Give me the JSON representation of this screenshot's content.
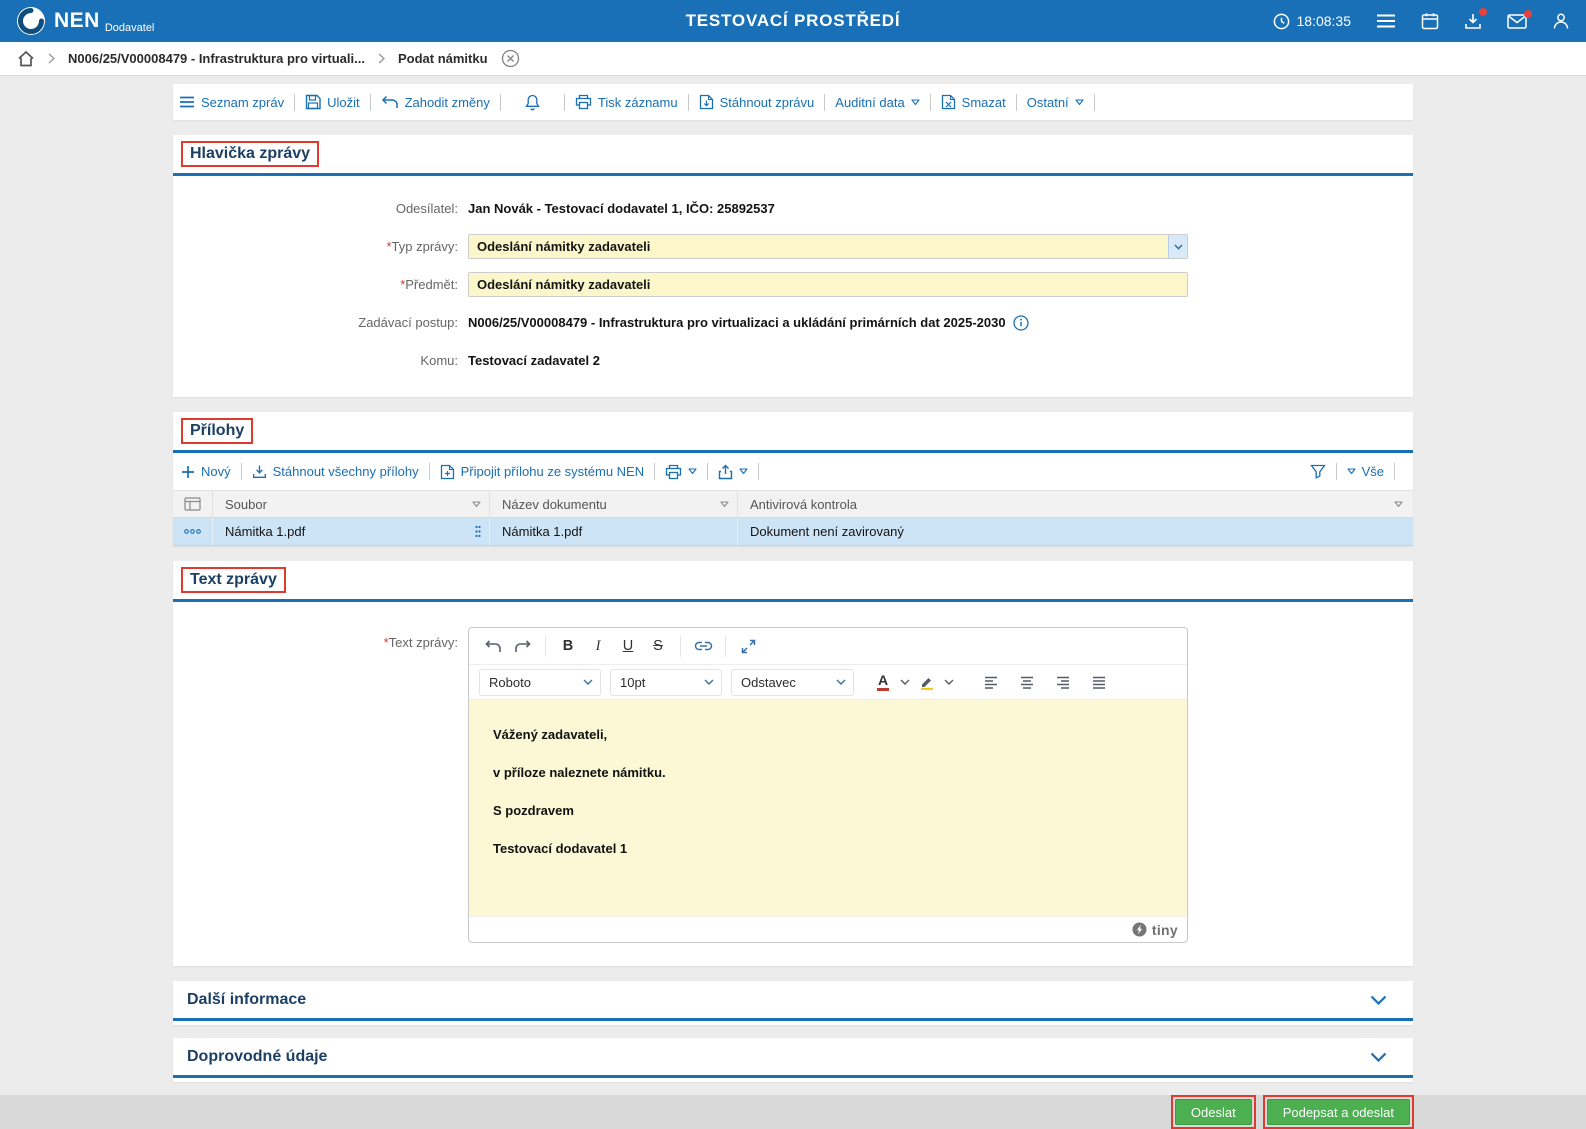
{
  "colors": {
    "header_blue": "#1a70b6",
    "link_blue": "#1a6fb5",
    "required_field_yellow": "#fcf7ca",
    "annotation_red": "#e03a2f",
    "selected_row_blue": "#cde3f6",
    "button_green": "#4caf50",
    "section_title_navy": "#1c4064"
  },
  "top_bar": {
    "brand": "NEN",
    "brand_sub": "Dodavatel",
    "title": "TESTOVACÍ PROSTŘEDÍ",
    "time": "18:08:35"
  },
  "breadcrumb": {
    "items": [
      {
        "label": "N006/25/V00008479 - Infrastruktura pro virtuali..."
      },
      {
        "label": "Podat námitku"
      }
    ]
  },
  "toolbar": {
    "items": [
      {
        "label": "Seznam zpráv"
      },
      {
        "label": "Uložit"
      },
      {
        "label": "Zahodit změny"
      },
      {
        "label": "Tisk záznamu"
      },
      {
        "label": "Stáhnout zprávu"
      },
      {
        "label": "Auditní data"
      },
      {
        "label": "Smazat"
      },
      {
        "label": "Ostatní"
      }
    ]
  },
  "misc": {
    "required_mark": "*"
  },
  "message_header": {
    "title": "Hlavička zprávy",
    "sender_label": "Odesílatel:",
    "sender_value": "Jan Novák - Testovací dodavatel 1, IČO: 25892537",
    "type_label": "Typ zprávy:",
    "type_value": "Odeslání námitky zadavateli",
    "subject_label": "Předmět:",
    "subject_value": "Odeslání námitky zadavateli",
    "procedure_label": "Zadávací postup:",
    "procedure_value": "N006/25/V00008479 - Infrastruktura pro virtualizaci a ukládání primárních dat 2025-2030",
    "recipient_label": "Komu:",
    "recipient_value": "Testovací zadavatel 2"
  },
  "attachments": {
    "title": "Přílohy",
    "toolbar": {
      "new": "Nový",
      "download_all": "Stáhnout všechny přílohy",
      "attach_nen": "Připojit přílohu ze systému NEN",
      "all": "Vše"
    },
    "columns": [
      "Soubor",
      "Název dokumentu",
      "Antivirová kontrola"
    ],
    "rows": [
      {
        "file": "Námitka 1.pdf",
        "document_name": "Námitka 1.pdf",
        "antivirus": "Dokument není zavirovaný"
      }
    ]
  },
  "message_text": {
    "title": "Text zprávy",
    "label": "Text zprávy:",
    "editor": {
      "font": "Roboto",
      "font_size": "10pt",
      "block_format": "Odstavec",
      "format_buttons": {
        "bold": "B",
        "italic": "I",
        "underline": "U",
        "strikethrough": "S"
      },
      "color_letter": "A",
      "paragraphs": [
        "Vážený zadavateli,",
        "v příloze naleznete námitku.",
        "S pozdravem",
        "Testovací dodavatel 1"
      ],
      "brand": "tiny"
    }
  },
  "more_sections": [
    {
      "title": "Další informace"
    },
    {
      "title": "Doprovodné údaje"
    }
  ],
  "footer": {
    "send": "Odeslat",
    "sign_and_send": "Podepsat a odeslat"
  }
}
